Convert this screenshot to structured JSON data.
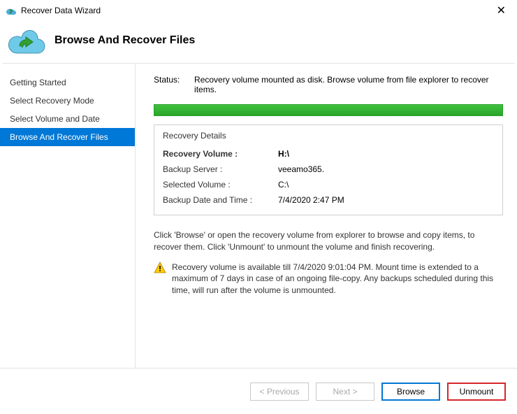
{
  "titlebar": {
    "title": "Recover Data Wizard"
  },
  "header": {
    "title": "Browse And Recover Files"
  },
  "sidebar": {
    "items": [
      {
        "label": "Getting Started"
      },
      {
        "label": "Select Recovery Mode"
      },
      {
        "label": "Select Volume and Date"
      },
      {
        "label": "Browse And Recover Files"
      }
    ]
  },
  "content": {
    "status_label": "Status:",
    "status_text": "Recovery volume mounted as disk. Browse volume from file explorer to recover items.",
    "details_title": "Recovery Details",
    "details": [
      {
        "k": "Recovery Volume  :",
        "v": "H:\\"
      },
      {
        "k": "Backup Server :",
        "v": "veeamo365."
      },
      {
        "k": "Selected Volume :",
        "v": "C:\\"
      },
      {
        "k": "Backup Date and Time :",
        "v": "7/4/2020 2:47 PM"
      }
    ],
    "info_text": "Click 'Browse' or open the recovery volume from explorer to browse and copy items, to recover them. Click 'Unmount' to unmount the volume and finish recovering.",
    "warn_text": "Recovery volume is available till 7/4/2020 9:01:04 PM. Mount time is extended to a maximum of 7 days in case of an ongoing file-copy. Any backups scheduled during this time, will run after the volume is unmounted."
  },
  "footer": {
    "previous": "< Previous",
    "next": "Next >",
    "browse": "Browse",
    "unmount": "Unmount"
  }
}
